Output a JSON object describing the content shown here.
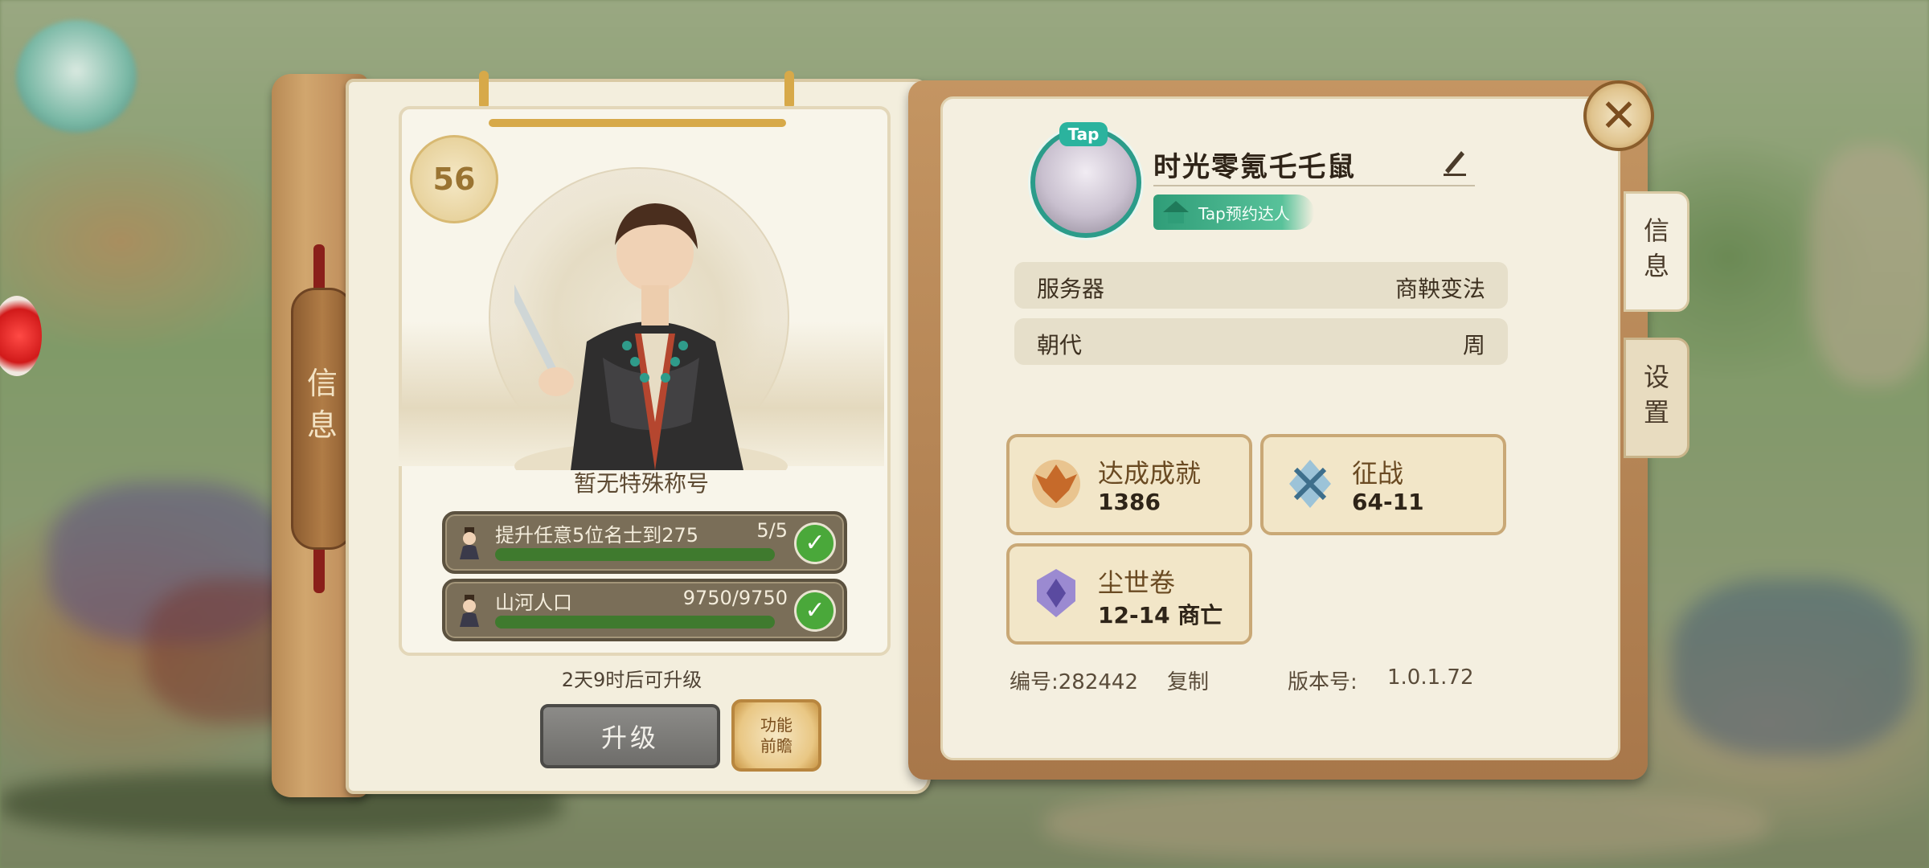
{
  "colors": {
    "parchment": "#f4efe0",
    "leather": "#c49562",
    "progress_green": "#3f7a2e",
    "check_green": "#4aa83a",
    "tap_teal": "#2b9c8a"
  },
  "left_panel": {
    "spine_tab": [
      "信",
      "息"
    ],
    "level": "56",
    "title": "暂无特殊称号",
    "quests": [
      {
        "label": "提升任意5位名士到275",
        "progress_text": "5/5",
        "progress": 1.0
      },
      {
        "label": "山河人口",
        "progress_text": "9750/9750",
        "progress": 1.0
      }
    ],
    "upgrade_note": "2天9时后可升级",
    "upgrade_button": "升级",
    "preview_button": [
      "功能",
      "前瞻"
    ]
  },
  "right_panel": {
    "tap_tag": "Tap",
    "player_name": "时光零氪乇乇鼠",
    "badge_text": "Tap预约达人",
    "info_rows": [
      {
        "key": "服务器",
        "value": "商鞅变法"
      },
      {
        "key": "朝代",
        "value": "周"
      }
    ],
    "stats": [
      {
        "label": "达成成就",
        "value": "1386",
        "icon": "phoenix-emblem-icon"
      },
      {
        "label": "征战",
        "value": "64-11",
        "icon": "crossed-swords-icon"
      },
      {
        "label": "尘世卷",
        "value": "12-14 商亡",
        "icon": "purple-crest-icon"
      }
    ],
    "id_label": "编号:282442",
    "copy_label": "复制",
    "version_label": "版本号:",
    "version": "1.0.1.72"
  },
  "tabs": [
    {
      "label": [
        "信",
        "息"
      ],
      "active": true
    },
    {
      "label": [
        "设",
        "置"
      ],
      "active": false
    }
  ]
}
